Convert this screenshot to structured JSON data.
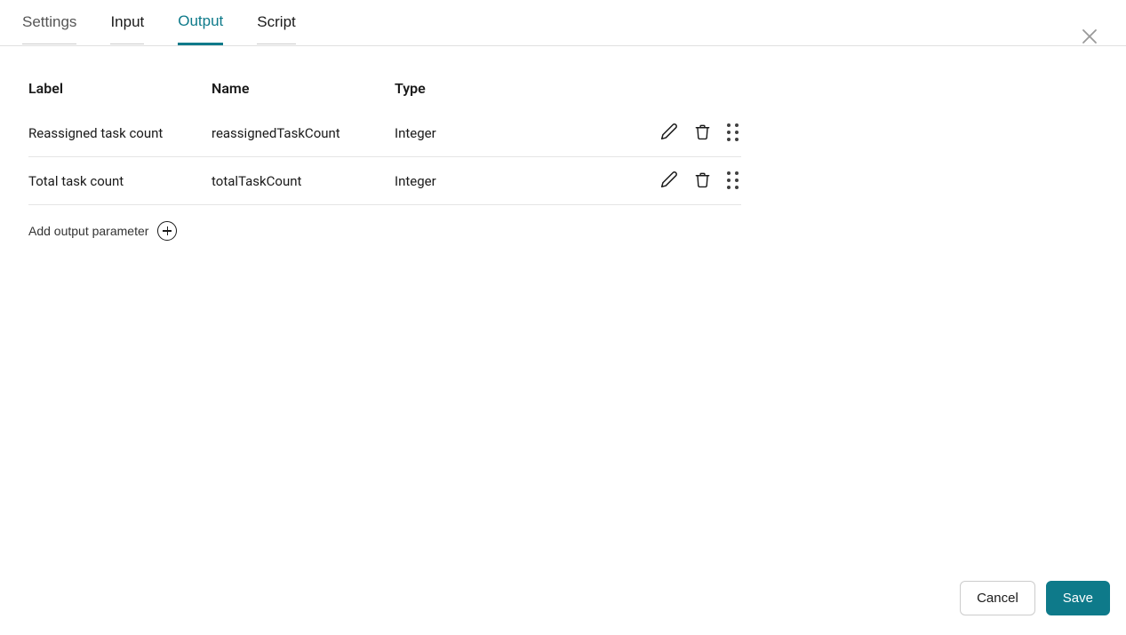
{
  "tabs": {
    "settings": "Settings",
    "input": "Input",
    "output": "Output",
    "script": "Script"
  },
  "table": {
    "headers": {
      "label": "Label",
      "name": "Name",
      "type": "Type"
    },
    "rows": [
      {
        "label": "Reassigned task count",
        "name": "reassignedTaskCount",
        "type": "Integer"
      },
      {
        "label": "Total task count",
        "name": "totalTaskCount",
        "type": "Integer"
      }
    ]
  },
  "addButton": "Add output parameter",
  "footer": {
    "cancel": "Cancel",
    "save": "Save"
  }
}
